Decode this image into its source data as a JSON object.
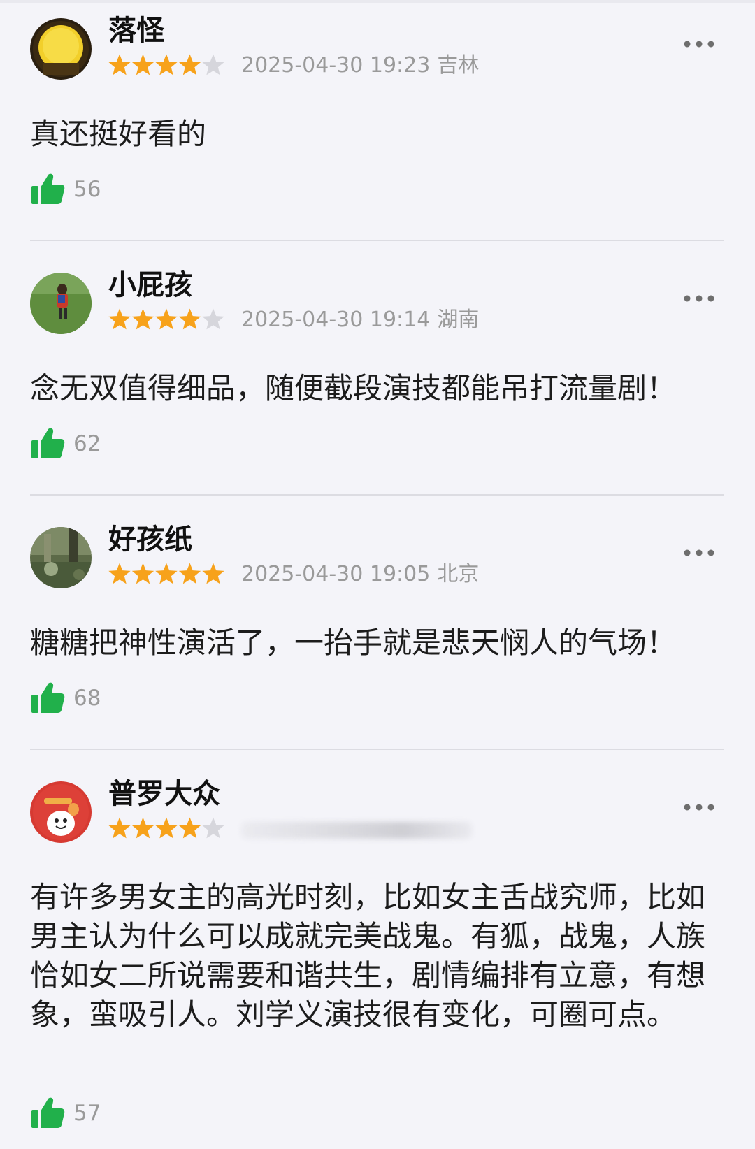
{
  "colors": {
    "background": "#f4f4f9",
    "star_filled": "#f7a21b",
    "star_empty": "#d6d6dc",
    "like_green": "#21b04b",
    "meta_gray": "#9a9a9a"
  },
  "icons": {
    "more": "more-horizontal-icon",
    "like": "thumbs-up-icon",
    "star": "star-icon"
  },
  "comments": [
    {
      "username": "落怪",
      "rating": 4,
      "date": "2025-04-30 19:23",
      "location": "吉林",
      "content": "真还挺好看的",
      "likes": "56"
    },
    {
      "username": "小屁孩",
      "rating": 4,
      "date": "2025-04-30 19:14",
      "location": "湖南",
      "content": "念无双值得细品，随便截段演技都能吊打流量剧！",
      "likes": "62"
    },
    {
      "username": "好孩纸",
      "rating": 5,
      "date": "2025-04-30 19:05",
      "location": "北京",
      "content": "糖糖把神性演活了，一抬手就是悲天悯人的气场！",
      "likes": "68"
    },
    {
      "username": "普罗大众",
      "rating": 4,
      "content": "有许多男女主的高光时刻，比如女主舌战究师，比如男主认为什么可以成就完美战鬼。有狐，战鬼，人族恰如女二所说需要和谐共生，剧情编排有立意，有想象，蛮吸引人。刘学义演技很有变化，可圈可点。",
      "likes": "57"
    }
  ]
}
